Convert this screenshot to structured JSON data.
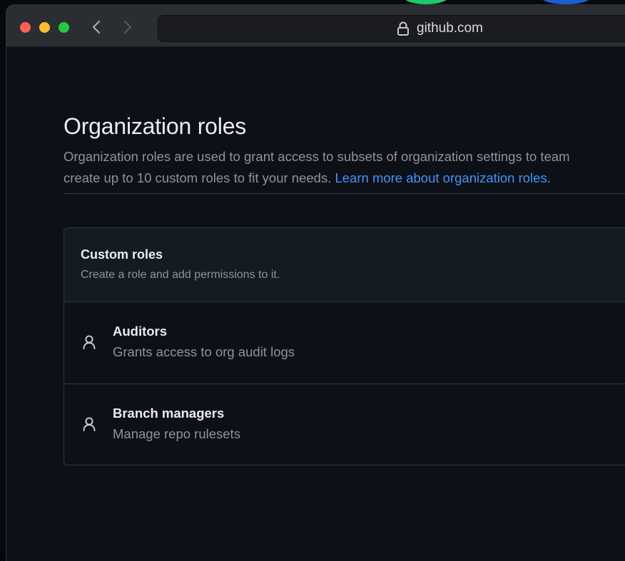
{
  "browser": {
    "url": "github.com"
  },
  "page": {
    "title": "Organization roles",
    "description_line1": "Organization roles are used to grant access to subsets of organization settings to team",
    "description_line2": "create up to 10 custom roles to fit your needs.",
    "learn_more_link": "Learn more about organization roles."
  },
  "custom_roles": {
    "title": "Custom roles",
    "subtitle": "Create a role and add permissions to it.",
    "roles": [
      {
        "name": "Auditors",
        "description": "Grants access to org audit logs",
        "icon": "person-icon"
      },
      {
        "name": "Branch managers",
        "description": "Manage repo rulesets",
        "icon": "person-icon"
      }
    ]
  },
  "colors": {
    "background": "#0d1117",
    "panel_header": "#151b23",
    "border": "#30363d",
    "text_primary": "#e6edf3",
    "text_secondary": "#8b949e",
    "link": "#4493f8",
    "close": "#fe5f57",
    "minimize": "#febc2e",
    "zoom": "#28c840"
  }
}
